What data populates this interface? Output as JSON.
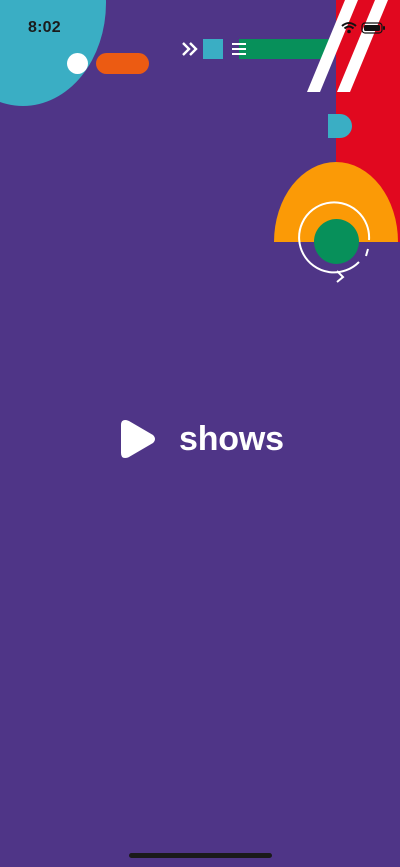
{
  "status_bar": {
    "time": "8:02",
    "icons": [
      "cellular-signal-icon",
      "wifi-icon",
      "battery-icon"
    ]
  },
  "logo": {
    "icon": "play-icon",
    "wordmark": "shows"
  },
  "colors": {
    "background": "#4f3587",
    "teal": "#3aaec4",
    "orange": "#ec5b12",
    "green": "#07905a",
    "red": "#e1081f",
    "amber": "#fb9a06",
    "white": "#ffffff"
  }
}
